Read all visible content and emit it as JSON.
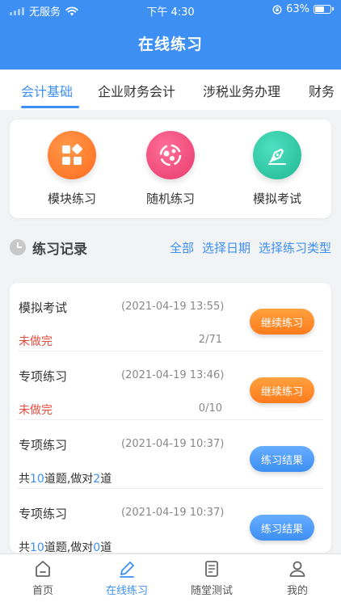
{
  "status_bar": {
    "carrier": "无服务",
    "time": "下午 4:30",
    "battery": "63%",
    "battery_level": 0.63
  },
  "header": {
    "title": "在线练习"
  },
  "tabs": [
    {
      "label": "会计基础"
    },
    {
      "label": "企业财务会计"
    },
    {
      "label": "涉税业务办理"
    },
    {
      "label": "财务"
    }
  ],
  "modes": [
    {
      "label": "模块练习",
      "icon": "grid-icon",
      "color": "#ff7a2b"
    },
    {
      "label": "随机练习",
      "icon": "shuffle-icon",
      "color": "#f0487a"
    },
    {
      "label": "模拟考试",
      "icon": "pen-nib-icon",
      "color": "#25c8a8"
    }
  ],
  "records": {
    "title": "练习记录",
    "filters": [
      "全部",
      "选择日期",
      "选择练习类型"
    ],
    "items": [
      {
        "name": "模拟考试",
        "time": "(2021-04-19 13:55)",
        "status": "未做完",
        "progress": "2/71",
        "button": "继续练习"
      },
      {
        "name": "专项练习",
        "time": "(2021-04-19 13:46)",
        "status": "未做完",
        "progress": "0/10",
        "button": "继续练习"
      },
      {
        "name": "专项练习",
        "time": "(2021-04-19 10:37)",
        "summary": {
          "prefix": "共",
          "total": "10",
          "middle": "道题,做对",
          "correct": "2",
          "suffix": "道"
        },
        "button": "练习结果"
      },
      {
        "name": "专项练习",
        "time": "(2021-04-19 10:37)",
        "summary": {
          "prefix": "共",
          "total": "10",
          "middle": "道题,做对",
          "correct": "0",
          "suffix": "道"
        },
        "button": "练习结果"
      }
    ]
  },
  "bottom_nav": [
    {
      "label": "首页",
      "icon": "home-icon"
    },
    {
      "label": "在线练习",
      "icon": "pencil-icon"
    },
    {
      "label": "随堂测试",
      "icon": "document-icon"
    },
    {
      "label": "我的",
      "icon": "user-icon"
    }
  ],
  "colors": {
    "accent": "#3d8ff3",
    "warning": "#e54b3c",
    "orange": "#ff7b1c"
  }
}
